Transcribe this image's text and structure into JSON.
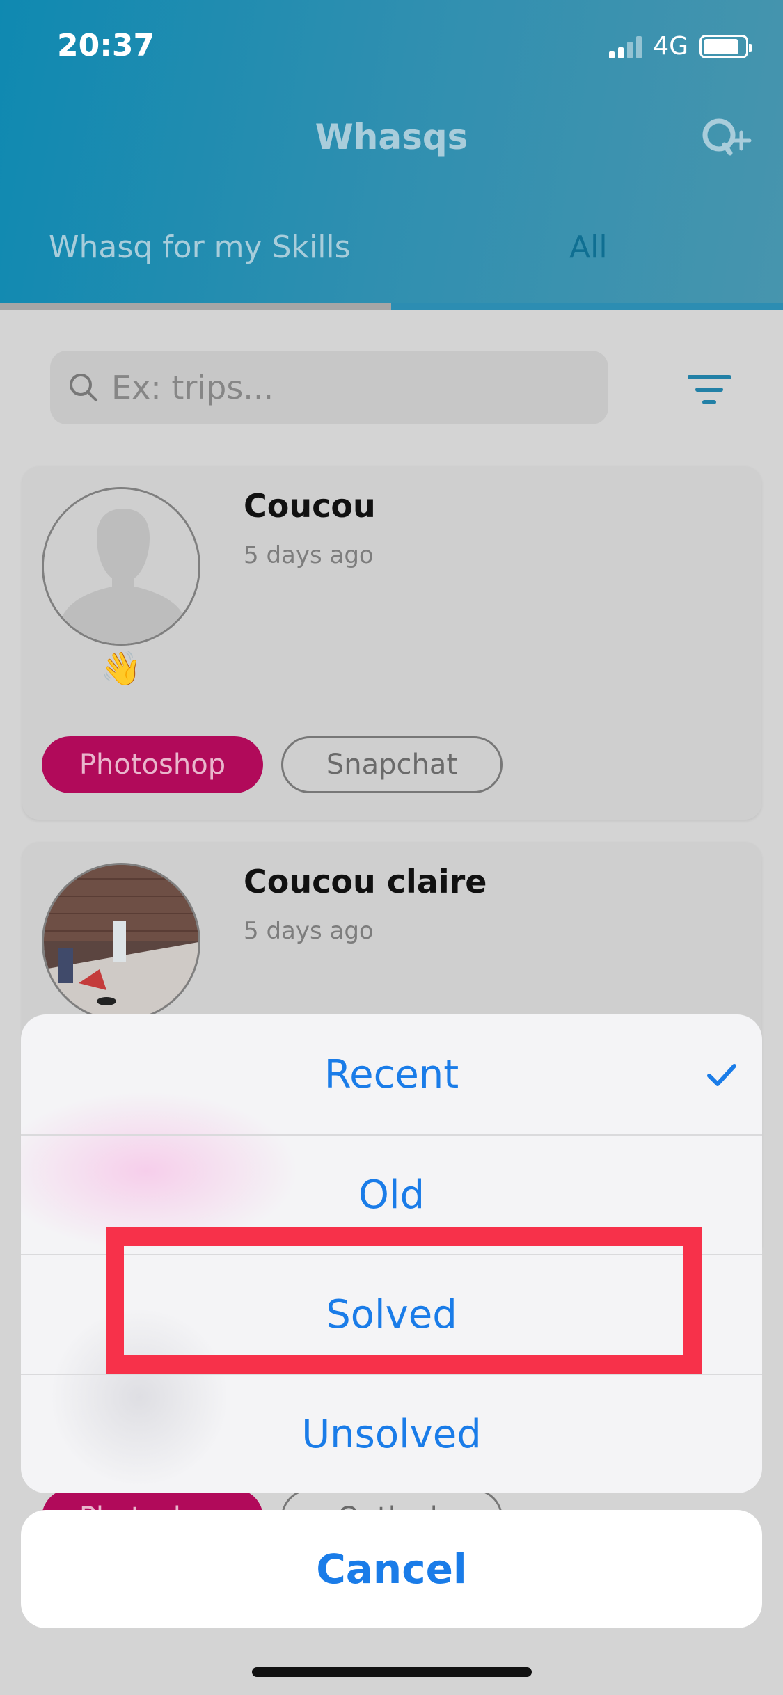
{
  "status_bar": {
    "time": "20:37",
    "network": "4G"
  },
  "header": {
    "title": "Whasqs",
    "add_icon": "question-add-icon"
  },
  "tabs": [
    {
      "label": "Whasq for my Skills",
      "active": true
    },
    {
      "label": "All",
      "active": false
    }
  ],
  "search": {
    "placeholder": "Ex: trips..."
  },
  "cards": [
    {
      "title": "Coucou",
      "time": "5 days ago",
      "emoji": "👋",
      "tags": [
        "Photoshop",
        "Snapchat"
      ]
    },
    {
      "title": "Coucou claire",
      "time": "5 days ago",
      "tags": [
        "Photoshop",
        "Outlook"
      ]
    }
  ],
  "action_sheet": {
    "options": [
      "Recent",
      "Old",
      "Solved",
      "Unsolved"
    ],
    "selected": "Recent",
    "highlighted": "Solved",
    "cancel_label": "Cancel"
  },
  "colors": {
    "accent": "#1a7ce8",
    "header": "#1a8ab2",
    "tag": "#b10a5a",
    "highlight": "#f7314a"
  }
}
